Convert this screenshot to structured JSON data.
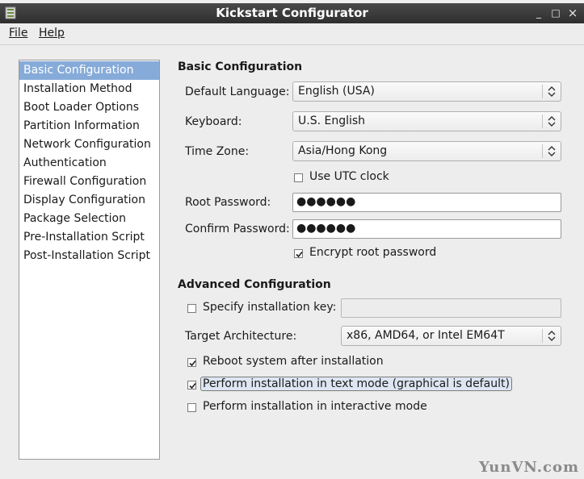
{
  "window": {
    "title": "Kickstart Configurator",
    "minimize": "_",
    "maximize": "□",
    "close": "×"
  },
  "menu": {
    "file": "File",
    "help": "Help"
  },
  "sidebar": {
    "items": [
      {
        "label": "Basic Configuration",
        "selected": true
      },
      {
        "label": "Installation Method"
      },
      {
        "label": "Boot Loader Options"
      },
      {
        "label": "Partition Information"
      },
      {
        "label": "Network Configuration"
      },
      {
        "label": "Authentication"
      },
      {
        "label": "Firewall Configuration"
      },
      {
        "label": "Display Configuration"
      },
      {
        "label": "Package Selection"
      },
      {
        "label": "Pre-Installation Script"
      },
      {
        "label": "Post-Installation Script"
      }
    ]
  },
  "basic": {
    "heading": "Basic Configuration",
    "language_label": "Default Language:",
    "language_value": "English (USA)",
    "keyboard_label": "Keyboard:",
    "keyboard_value": "U.S. English",
    "timezone_label": "Time Zone:",
    "timezone_value": "Asia/Hong Kong",
    "utc_label": "Use UTC clock",
    "utc_checked": false,
    "root_pw_label": "Root Password:",
    "root_pw_value": "●●●●●●",
    "confirm_pw_label": "Confirm Password:",
    "confirm_pw_value": "●●●●●●",
    "encrypt_label": "Encrypt root password",
    "encrypt_checked": true
  },
  "advanced": {
    "heading": "Advanced Configuration",
    "install_key_label": "Specify installation key:",
    "install_key_checked": false,
    "install_key_value": "",
    "arch_label": "Target Architecture:",
    "arch_value": "x86, AMD64, or Intel EM64T",
    "reboot_label": "Reboot system after installation",
    "reboot_checked": true,
    "textmode_label": "Perform installation in text mode (graphical is default)",
    "textmode_checked": true,
    "interactive_label": "Perform installation in interactive mode",
    "interactive_checked": false
  },
  "watermark": "YunVN.com",
  "colors": {
    "selection": "#86abd9",
    "titlebar": "#3a3a3a",
    "window_bg": "#ededed"
  }
}
